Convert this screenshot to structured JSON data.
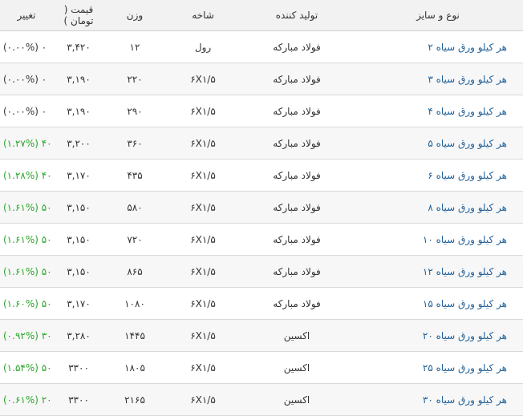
{
  "headers": {
    "name": "نوع و سایز",
    "producer": "تولید کننده",
    "branch": "شاخه",
    "weight": "وزن",
    "price": "قیمت ( تومان )",
    "change": "تغییر"
  },
  "colors": {
    "link": "#1f5f97",
    "up": "#2aa52a"
  },
  "rows": [
    {
      "name": "هر کیلو ورق سیاه ۲",
      "producer": "فولاد مبارکه",
      "branch": "رول",
      "weight": "۱۲",
      "price": "۳,۴۲۰",
      "change": "(۰.۰۰%) ۰",
      "dir": "flat"
    },
    {
      "name": "هر کیلو ورق سیاه ۳",
      "producer": "فولاد مبارکه",
      "branch": "۶X۱/۵",
      "weight": "۲۲۰",
      "price": "۳,۱۹۰",
      "change": "(۰.۰۰%) ۰",
      "dir": "flat"
    },
    {
      "name": "هر کیلو ورق سیاه ۴",
      "producer": "فولاد مبارکه",
      "branch": "۶X۱/۵",
      "weight": "۲۹۰",
      "price": "۳,۱۹۰",
      "change": "(۰.۰۰%) ۰",
      "dir": "flat"
    },
    {
      "name": "هر کیلو ورق سیاه ۵",
      "producer": "فولاد مبارکه",
      "branch": "۶X۱/۵",
      "weight": "۳۶۰",
      "price": "۳,۲۰۰",
      "change": "(۱.۲۷%) ۴۰",
      "dir": "up"
    },
    {
      "name": "هر کیلو ورق سیاه ۶",
      "producer": "فولاد مبارکه",
      "branch": "۶X۱/۵",
      "weight": "۴۳۵",
      "price": "۳,۱۷۰",
      "change": "(۱.۲۸%) ۴۰",
      "dir": "up"
    },
    {
      "name": "هر کیلو ورق سیاه ۸",
      "producer": "فولاد مبارکه",
      "branch": "۶X۱/۵",
      "weight": "۵۸۰",
      "price": "۳,۱۵۰",
      "change": "(۱.۶۱%) ۵۰",
      "dir": "up"
    },
    {
      "name": "هر کیلو ورق سیاه ۱۰",
      "producer": "فولاد مبارکه",
      "branch": "۶X۱/۵",
      "weight": "۷۲۰",
      "price": "۳,۱۵۰",
      "change": "(۱.۶۱%) ۵۰",
      "dir": "up"
    },
    {
      "name": "هر کیلو ورق سیاه ۱۲",
      "producer": "فولاد مبارکه",
      "branch": "۶X۱/۵",
      "weight": "۸۶۵",
      "price": "۳,۱۵۰",
      "change": "(۱.۶۱%) ۵۰",
      "dir": "up"
    },
    {
      "name": "هر کیلو ورق سیاه ۱۵",
      "producer": "فولاد مبارکه",
      "branch": "۶X۱/۵",
      "weight": "۱۰۸۰",
      "price": "۳,۱۷۰",
      "change": "(۱.۶۰%) ۵۰",
      "dir": "up"
    },
    {
      "name": "هر کیلو ورق سیاه ۲۰",
      "producer": "اکسین",
      "branch": "۶X۱/۵",
      "weight": "۱۴۴۵",
      "price": "۳,۲۸۰",
      "change": "(۰.۹۲%) ۳۰",
      "dir": "up"
    },
    {
      "name": "هر کیلو ورق سیاه ۲۵",
      "producer": "اکسین",
      "branch": "۶X۱/۵",
      "weight": "۱۸۰۵",
      "price": "۳۳۰۰",
      "change": "(۱.۵۴%) ۵۰",
      "dir": "up"
    },
    {
      "name": "هر کیلو ورق سیاه ۳۰",
      "producer": "اکسین",
      "branch": "۶X۱/۵",
      "weight": "۲۱۶۵",
      "price": "۳۳۰۰",
      "change": "(۰.۶۱%) ۲۰",
      "dir": "up"
    }
  ]
}
